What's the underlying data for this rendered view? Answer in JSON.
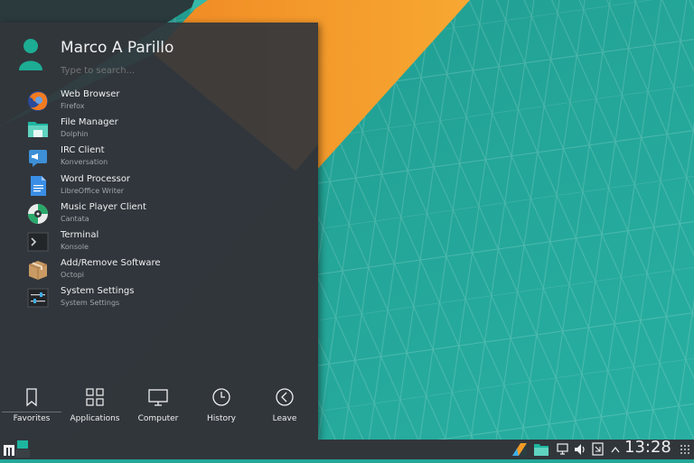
{
  "user": {
    "name": "Marco A Parillo",
    "search_placeholder": "Type to search..."
  },
  "favorites": [
    {
      "name": "Web Browser",
      "app": "Firefox",
      "icon": "firefox-icon"
    },
    {
      "name": "File Manager",
      "app": "Dolphin",
      "icon": "folder-icon"
    },
    {
      "name": "IRC Client",
      "app": "Konversation",
      "icon": "chat-icon"
    },
    {
      "name": "Word Processor",
      "app": "LibreOffice Writer",
      "icon": "document-icon"
    },
    {
      "name": "Music Player Client",
      "app": "Cantata",
      "icon": "music-player-icon"
    },
    {
      "name": "Terminal",
      "app": "Konsole",
      "icon": "terminal-icon"
    },
    {
      "name": "Add/Remove Software",
      "app": "Octopi",
      "icon": "package-icon"
    },
    {
      "name": "System Settings",
      "app": "System Settings",
      "icon": "settings-icon"
    }
  ],
  "tabs": [
    {
      "label": "Favorites",
      "icon": "bookmark-icon"
    },
    {
      "label": "Applications",
      "icon": "grid-icon"
    },
    {
      "label": "Computer",
      "icon": "monitor-icon"
    },
    {
      "label": "History",
      "icon": "clock-icon"
    },
    {
      "label": "Leave",
      "icon": "back-arrow-icon"
    }
  ],
  "taskbar": {
    "time": "13:28"
  },
  "colors": {
    "teal": "#24a89a",
    "orange": "#f39a26",
    "panel": "#31363b",
    "accent": "#3daee9"
  }
}
